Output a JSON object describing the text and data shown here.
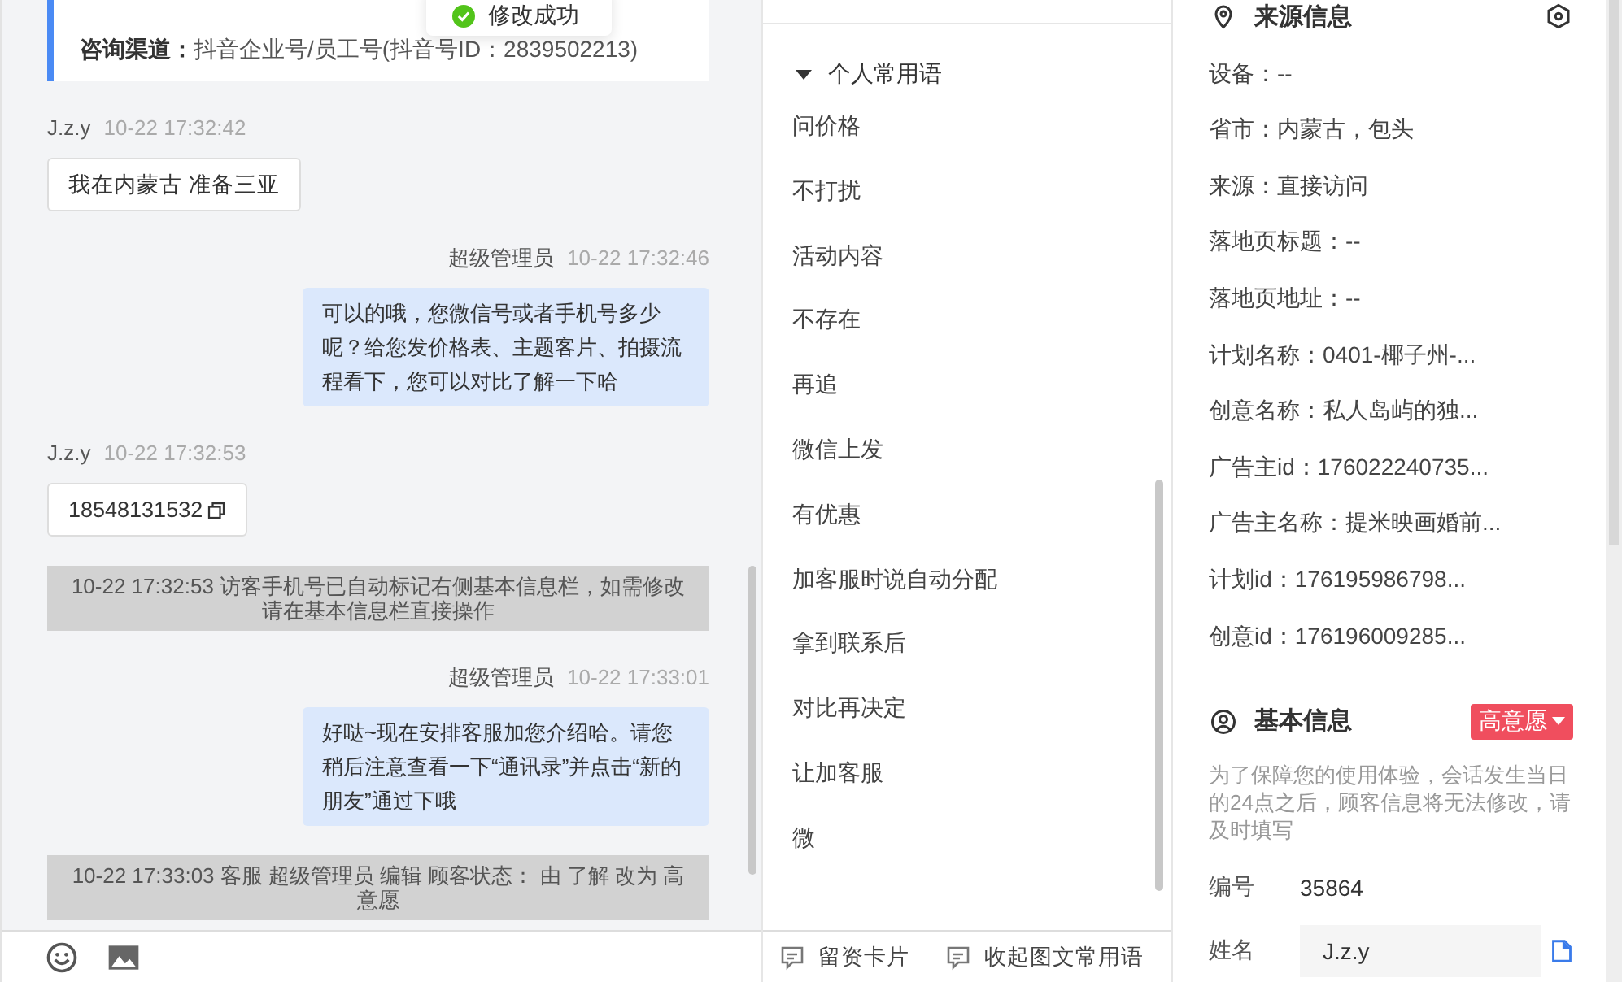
{
  "toast": {
    "text": "修改成功"
  },
  "chat": {
    "channel": {
      "label": "咨询渠道：",
      "value": "抖音企业号/员工号(抖音号ID：2839502213)"
    },
    "messages": [
      {
        "kind": "visitor",
        "sender": "J.z.y",
        "time": "10-22 17:32:42",
        "text": "我在内蒙古 准备三亚",
        "copyable": false
      },
      {
        "kind": "agent",
        "sender": "超级管理员",
        "time": "10-22 17:32:46",
        "text": "可以的哦，您微信号或者手机号多少呢？给您发价格表、主题客片、拍摄流程看下，您可以对比了解一下哈"
      },
      {
        "kind": "visitor",
        "sender": "J.z.y",
        "time": "10-22 17:32:53",
        "text": "18548131532",
        "copyable": true
      },
      {
        "kind": "system",
        "text": "10-22 17:32:53 访客手机号已自动标记右侧基本信息栏，如需修改请在基本信息栏直接操作"
      },
      {
        "kind": "agent",
        "sender": "超级管理员",
        "time": "10-22 17:33:01",
        "text": "好哒~现在安排客服加您介绍哈。请您稍后注意查看一下“通讯录”并点击“新的朋友”通过下哦"
      },
      {
        "kind": "system",
        "text": "10-22 17:33:03 客服 超级管理员 编辑 顾客状态： 由 了解 改为 高意愿"
      }
    ]
  },
  "quick_replies": {
    "group": {
      "label": "个人常用语",
      "expanded": true
    },
    "items": [
      "问价格",
      "不打扰",
      "活动内容",
      "不存在",
      "再追",
      "微信上发",
      "有优惠",
      "加客服时说自动分配",
      "拿到联系后",
      "对比再决定",
      "让加客服",
      "微"
    ],
    "footer_buttons": [
      "留资卡片",
      "收起图文常用语"
    ]
  },
  "source_info": {
    "title": "来源信息",
    "lines": [
      "设备：--",
      "省市：内蒙古，包头",
      "来源：直接访问",
      "落地页标题：--",
      "落地页地址：--",
      "计划名称：0401-椰子州-...",
      "创意名称：私人岛屿的独...",
      "广告主id：176022240735...",
      "广告主名称：提米映画婚前...",
      "计划id：176195986798...",
      "创意id：176196009285..."
    ]
  },
  "basic_info": {
    "title": "基本信息",
    "intent_tag": "高意愿",
    "note": "为了保障您的使用体验，会话发生当日的24点之后，顾客信息将无法修改，请及时填写",
    "fields": [
      {
        "kind": "text",
        "label": "编号",
        "value": "35864"
      },
      {
        "kind": "input",
        "label": "姓名",
        "value": "J.z.y"
      }
    ]
  }
}
